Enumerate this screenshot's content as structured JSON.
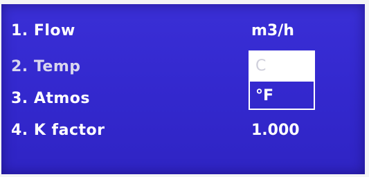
{
  "menu": {
    "items": [
      {
        "label": "1. Flow",
        "value": "m3/h"
      },
      {
        "label": "2. Temp",
        "value": ""
      },
      {
        "label": "3. Atmos",
        "value": ""
      },
      {
        "label": "4. K  factor",
        "value": "1.000"
      }
    ]
  },
  "temp_unit_dropdown": {
    "options": [
      "C",
      "°F"
    ],
    "selected": "°F"
  },
  "colors": {
    "screen_background": "#3429cf",
    "text": "#ffffff",
    "unselected_option_bg": "#ffffff"
  }
}
